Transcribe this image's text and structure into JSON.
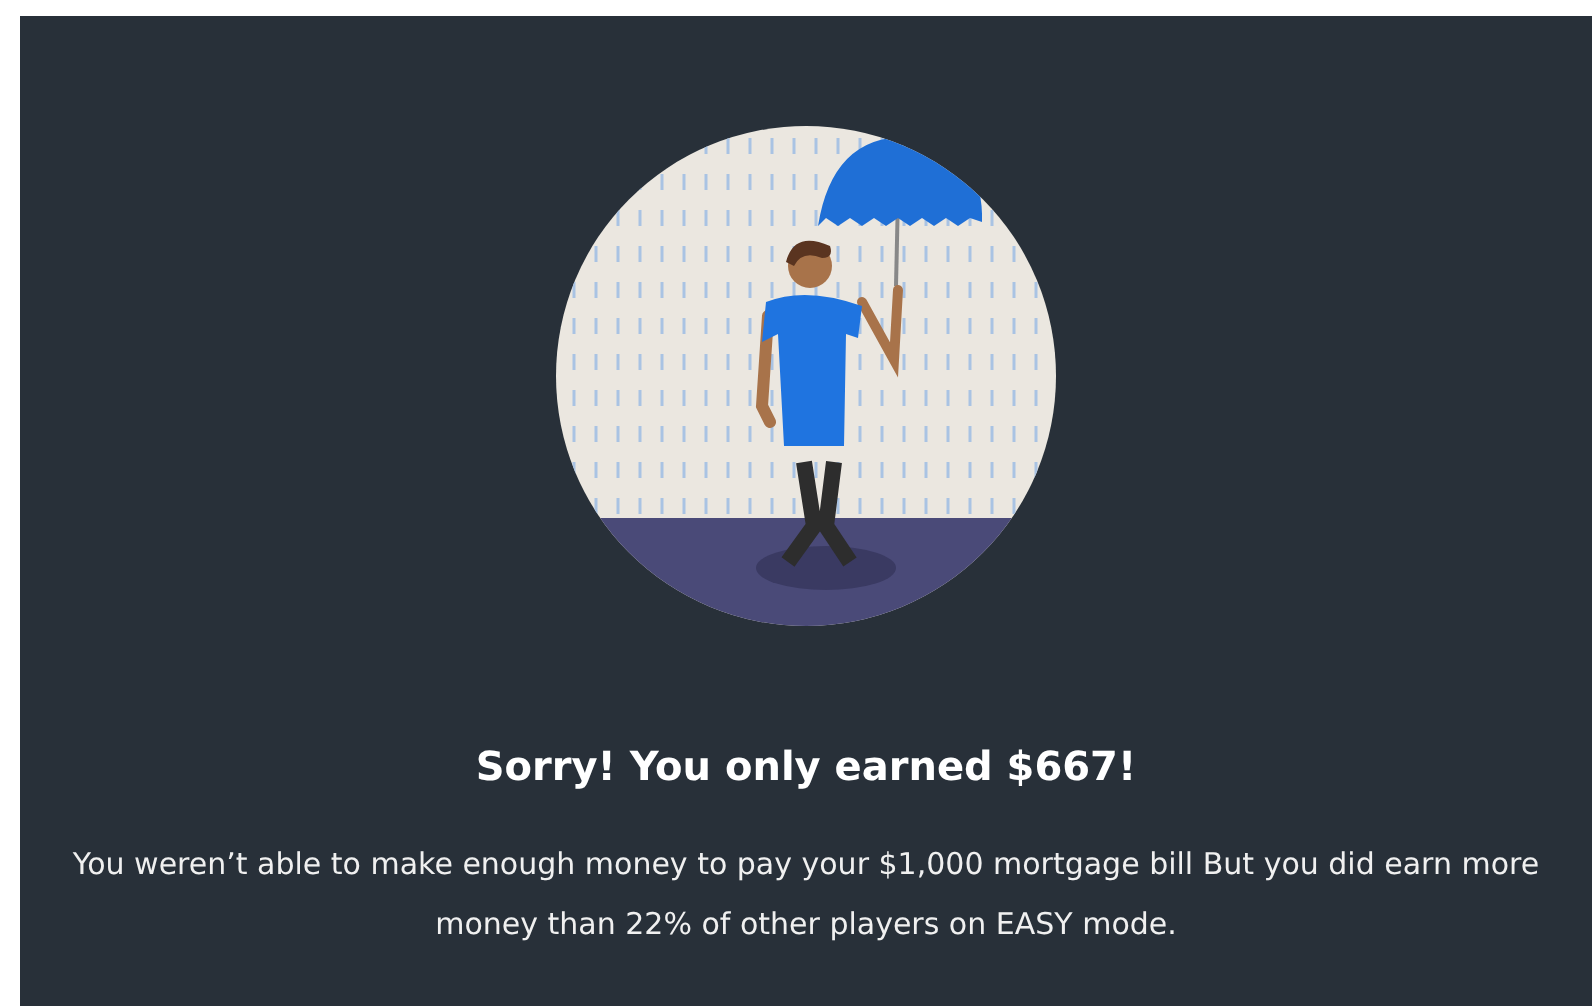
{
  "result": {
    "title": "Sorry! You only earned $667!",
    "message": "You weren’t able to make enough money to pay your $1,000 mortgage bill But you did earn more money than 22% of other players on EASY mode."
  }
}
